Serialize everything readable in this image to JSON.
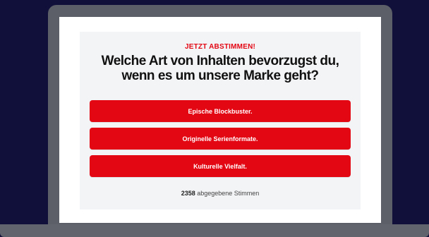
{
  "colors": {
    "background": "#11103a",
    "device_frame": "#5c5f67",
    "screen": "#ffffff",
    "card": "#f3f4f6",
    "accent": "#e30613",
    "text_dark": "#111111"
  },
  "poll": {
    "kicker": "JETZT ABSTIMMEN!",
    "question": "Welche Art von Inhalten bevorzugst du, wenn es um unsere Marke geht?",
    "options": [
      {
        "label": "Epische Blockbuster."
      },
      {
        "label": "Originelle Serienformate."
      },
      {
        "label": "Kulturelle Vielfalt."
      }
    ],
    "vote_count": "2358",
    "vote_suffix": "abgegebene Stimmen"
  }
}
